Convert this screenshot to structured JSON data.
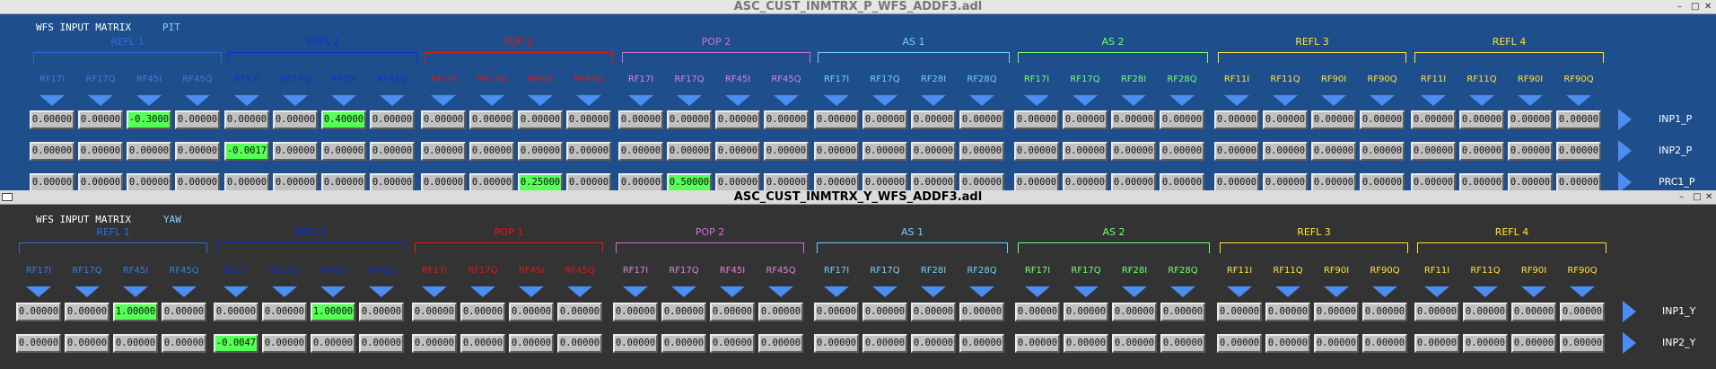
{
  "colors": {
    "on_cell": "#55ff55",
    "arrow": "#4b8df0"
  },
  "groups": [
    {
      "label": "REFL 1",
      "color": "#2d6fd6",
      "cols": [
        "RF17I",
        "RF17Q",
        "RF45I",
        "RF45Q"
      ],
      "col_color": "#3a7de0"
    },
    {
      "label": "REFL 2",
      "color": "#1030c8",
      "cols": [
        "RF17I",
        "RF17Q",
        "RF45I",
        "RF45Q"
      ],
      "col_color": "#1030d0"
    },
    {
      "label": "POP 1",
      "color": "#e01818",
      "cols": [
        "RF17I",
        "RF17Q",
        "RF45I",
        "RF45Q"
      ],
      "col_color": "#e01818"
    },
    {
      "label": "POP 2",
      "color": "#d070d0",
      "cols": [
        "RF17I",
        "RF17Q",
        "RF45I",
        "RF45Q"
      ],
      "col_color": "#dd80dd"
    },
    {
      "label": "AS 1",
      "color": "#70d0ff",
      "cols": [
        "RF17I",
        "RF17Q",
        "RF28I",
        "RF28Q"
      ],
      "col_color": "#70d0ff"
    },
    {
      "label": "AS 2",
      "color": "#70ff70",
      "cols": [
        "RF17I",
        "RF17Q",
        "RF28I",
        "RF28Q"
      ],
      "col_color": "#70ff70"
    },
    {
      "label": "REFL 3",
      "color": "#ffe03a",
      "cols": [
        "RF11I",
        "RF11Q",
        "RF90I",
        "RF90Q"
      ],
      "col_color": "#ffe03a"
    },
    {
      "label": "REFL 4",
      "color": "#ffe03a",
      "cols": [
        "RF11I",
        "RF11Q",
        "RF90I",
        "RF90Q"
      ],
      "col_color": "#ffe03a"
    }
  ],
  "window_p": {
    "title": "ASC_CUST_INMTRX_P_WFS_ADDF3.adl",
    "header": "WFS INPUT MATRIX",
    "dof": "PIT",
    "rows": [
      {
        "label": "INP1_P",
        "values": [
          "0.00000",
          "0.00000",
          "-0.3000",
          "0.00000",
          "0.00000",
          "0.00000",
          "0.40000",
          "0.00000",
          "0.00000",
          "0.00000",
          "0.00000",
          "0.00000",
          "0.00000",
          "0.00000",
          "0.00000",
          "0.00000",
          "0.00000",
          "0.00000",
          "0.00000",
          "0.00000",
          "0.00000",
          "0.00000",
          "0.00000",
          "0.00000",
          "0.00000",
          "0.00000",
          "0.00000",
          "0.00000",
          "0.00000",
          "0.00000",
          "0.00000",
          "0.00000"
        ],
        "on": [
          2,
          6
        ]
      },
      {
        "label": "INP2_P",
        "values": [
          "0.00000",
          "0.00000",
          "0.00000",
          "0.00000",
          "-0.0017",
          "0.00000",
          "0.00000",
          "0.00000",
          "0.00000",
          "0.00000",
          "0.00000",
          "0.00000",
          "0.00000",
          "0.00000",
          "0.00000",
          "0.00000",
          "0.00000",
          "0.00000",
          "0.00000",
          "0.00000",
          "0.00000",
          "0.00000",
          "0.00000",
          "0.00000",
          "0.00000",
          "0.00000",
          "0.00000",
          "0.00000",
          "0.00000",
          "0.00000",
          "0.00000",
          "0.00000"
        ],
        "on": [
          4
        ]
      },
      {
        "label": "PRC1_P",
        "values": [
          "0.00000",
          "0.00000",
          "0.00000",
          "0.00000",
          "0.00000",
          "0.00000",
          "0.00000",
          "0.00000",
          "0.00000",
          "0.00000",
          "0.25000",
          "0.00000",
          "0.00000",
          "0.50000",
          "0.00000",
          "0.00000",
          "0.00000",
          "0.00000",
          "0.00000",
          "0.00000",
          "0.00000",
          "0.00000",
          "0.00000",
          "0.00000",
          "0.00000",
          "0.00000",
          "0.00000",
          "0.00000",
          "0.00000",
          "0.00000",
          "0.00000",
          "0.00000"
        ],
        "on": [
          10,
          13
        ]
      }
    ]
  },
  "window_y": {
    "title": "ASC_CUST_INMTRX_Y_WFS_ADDF3.adl",
    "header": "WFS INPUT MATRIX",
    "dof": "YAW",
    "rows": [
      {
        "label": "INP1_Y",
        "values": [
          "0.00000",
          "0.00000",
          "1.00000",
          "0.00000",
          "0.00000",
          "0.00000",
          "1.00000",
          "0.00000",
          "0.00000",
          "0.00000",
          "0.00000",
          "0.00000",
          "0.00000",
          "0.00000",
          "0.00000",
          "0.00000",
          "0.00000",
          "0.00000",
          "0.00000",
          "0.00000",
          "0.00000",
          "0.00000",
          "0.00000",
          "0.00000",
          "0.00000",
          "0.00000",
          "0.00000",
          "0.00000",
          "0.00000",
          "0.00000",
          "0.00000",
          "0.00000"
        ],
        "on": [
          2,
          6
        ]
      },
      {
        "label": "INP2_Y",
        "values": [
          "0.00000",
          "0.00000",
          "0.00000",
          "0.00000",
          "-0.0047",
          "0.00000",
          "0.00000",
          "0.00000",
          "0.00000",
          "0.00000",
          "0.00000",
          "0.00000",
          "0.00000",
          "0.00000",
          "0.00000",
          "0.00000",
          "0.00000",
          "0.00000",
          "0.00000",
          "0.00000",
          "0.00000",
          "0.00000",
          "0.00000",
          "0.00000",
          "0.00000",
          "0.00000",
          "0.00000",
          "0.00000",
          "0.00000",
          "0.00000",
          "0.00000",
          "0.00000"
        ],
        "on": [
          4
        ]
      }
    ]
  }
}
